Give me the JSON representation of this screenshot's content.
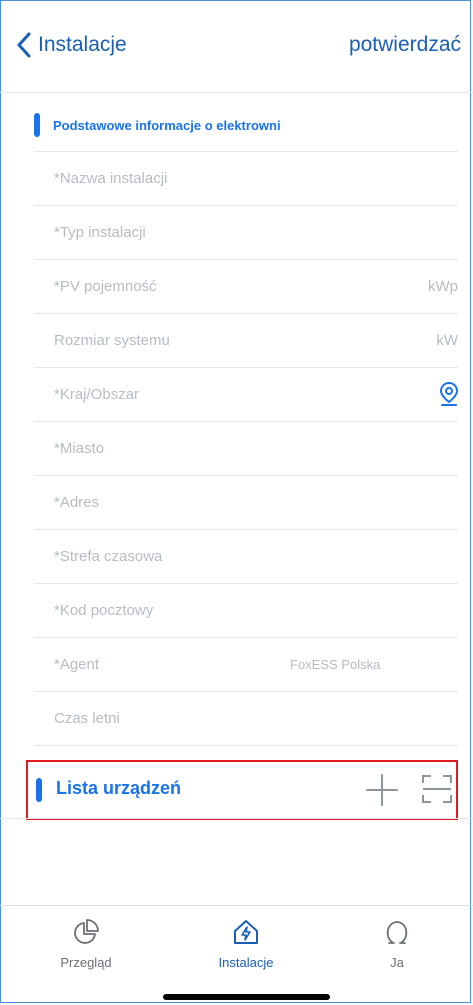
{
  "nav": {
    "back_label": "Instalacje",
    "confirm_label": "potwierdzać"
  },
  "section": {
    "title": "Podstawowe informacje o elektrowni"
  },
  "form": {
    "rows": [
      {
        "label": "*Nazwa instalacji"
      },
      {
        "label": "*Typ instalacji"
      },
      {
        "label": "*PV pojemność",
        "unit": "kWp"
      },
      {
        "label": "Rozmiar systemu",
        "unit": "kW"
      },
      {
        "label": "*Kraj/Obszar",
        "icon": "location-pin-icon"
      },
      {
        "label": "*Miasto"
      },
      {
        "label": "*Adres"
      },
      {
        "label": "*Strefa czasowa"
      },
      {
        "label": "*Kod pocztowy"
      },
      {
        "label": "*Agent",
        "value": "FoxESS Polska"
      },
      {
        "label": "Czas letni"
      }
    ]
  },
  "devices": {
    "title": "Lista urządzeń",
    "add_icon": "plus-icon",
    "scan_icon": "scan-icon"
  },
  "tabbar": {
    "tabs": [
      {
        "label": "Przegląd",
        "icon": "pie-chart-icon"
      },
      {
        "label": "Instalacje",
        "icon": "home-bolt-icon",
        "active": true
      },
      {
        "label": "Ja",
        "icon": "profile-icon"
      }
    ]
  },
  "colors": {
    "accent": "#1a73e8",
    "nav_text": "#1a5fb4",
    "placeholder": "#b6bcc4",
    "highlight_border": "#e01b24"
  }
}
